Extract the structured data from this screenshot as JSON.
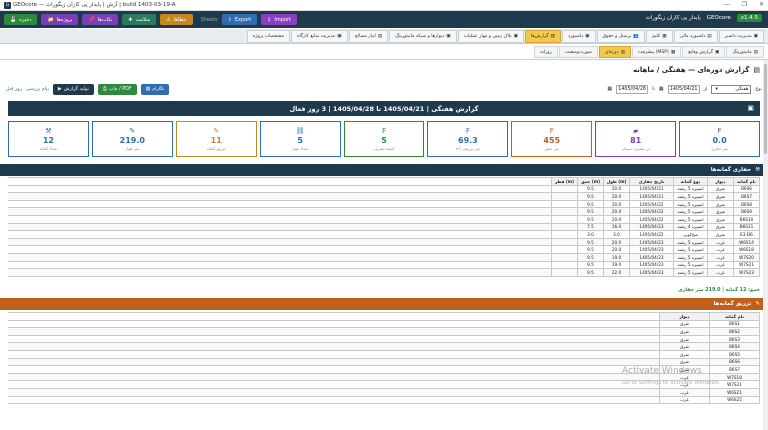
{
  "window": {
    "icon": "G",
    "title": "GEOcore — آرش | پایدار پی کاران زیگورات | build 1403-03-19-A",
    "controls": [
      "—",
      "❐",
      "✕"
    ]
  },
  "topbar": {
    "buttons": [
      {
        "label": "ذخیره",
        "icon": "💾"
      },
      {
        "label": "پروژه‌ها",
        "icon": "📁"
      },
      {
        "label": "نکات‌ها",
        "icon": "📌"
      },
      {
        "label": "سلامت",
        "icon": "✚"
      },
      {
        "label": "خطاها",
        "icon": "⚠"
      }
    ],
    "sep": "Sheets",
    "export": "Export",
    "import": "Import",
    "brand": "پایدار پی کاران زیگورات",
    "app": "GEOcore",
    "version": "v1.4.5"
  },
  "tabs": [
    {
      "label": "مدیریت داشبر",
      "icon": "▣",
      "active": false
    },
    {
      "label": "داشبورد مالی",
      "icon": "▤",
      "active": false
    },
    {
      "label": "کلیم",
      "icon": "▦",
      "active": false
    },
    {
      "label": "پرسنل و حقوق",
      "icon": "👥",
      "active": false
    },
    {
      "label": "داشبورد",
      "icon": "▣",
      "active": false
    },
    {
      "label": "گزارش‌ها",
      "icon": "▥",
      "active": true
    },
    {
      "label": "بلاک زمین و مهار عملیات",
      "icon": "▣",
      "active": false
    },
    {
      "label": "دیوارها و شبکه مانیتورینگ",
      "icon": "▣",
      "active": false
    },
    {
      "label": "انبار مصالح",
      "icon": "▤",
      "active": false
    },
    {
      "label": "مدیریت منابع کارگاه",
      "icon": "▣",
      "active": false
    },
    {
      "label": "مشخصات پروژه",
      "icon": "",
      "active": false
    }
  ],
  "subtabs": [
    {
      "label": "مانیتورینگ",
      "icon": "▤",
      "active": false
    },
    {
      "label": "گزارش وقایع",
      "icon": "▣",
      "active": false
    },
    {
      "label": "پیشرفت (MSP)",
      "icon": "▦",
      "active": false
    },
    {
      "label": "دوره‌ای",
      "icon": "▥",
      "active": true
    },
    {
      "label": "صورت‌وضعیت",
      "icon": "",
      "active": false
    },
    {
      "label": "روزانه",
      "icon": "",
      "active": false
    }
  ],
  "header": {
    "title": "گزارش دوره‌ای — هفتگی / ماهانه",
    "icon": "▤"
  },
  "filters": {
    "type_label": "نوع",
    "type_value": "هفتگی",
    "from_label": "از",
    "from_value": "1405/04/21",
    "to_label": "تا",
    "to_value": "1405/04/28",
    "generate": "تولید گزارش",
    "print": "چاپ / PDF",
    "graph": "نگارام",
    "link1": "پیام بررسی",
    "link2": "روز قبل"
  },
  "banner": {
    "text": "گزارش هفتگی  |  1405/04/21 تا 1405/04/28  |  3 روز فعال",
    "icon": "▣"
  },
  "cards": [
    {
      "icon": "F",
      "value": "0.0",
      "label": "متر حفاری",
      "color": "#2f6db0"
    },
    {
      "icon": "▰",
      "value": "81",
      "label": "تن مصرف سیمان",
      "color": "#7b3fb5"
    },
    {
      "icon": "F",
      "value": "455",
      "label": "متر عمق",
      "color": "#c0601c"
    },
    {
      "icon": "F",
      "value": "69.3",
      "label": "m³ بتن تزریقی",
      "color": "#2f6db0"
    },
    {
      "icon": "F",
      "value": "5",
      "label": "کیسه مصرف",
      "color": "#2d8a3c"
    },
    {
      "icon": "⛓",
      "value": "5",
      "label": "تعداد مهار",
      "color": "#2f6db0"
    },
    {
      "icon": "✎",
      "value": "11",
      "label": "تزریق گمانه",
      "color": "#c48a1c"
    },
    {
      "icon": "✎",
      "value": "219.0",
      "label": "متر طول",
      "color": "#2f6db0"
    },
    {
      "icon": "⚒",
      "value": "12",
      "label": "تعداد گمانه",
      "color": "#2f6db0"
    }
  ],
  "section1": {
    "title": "حفاری گمانه‌ها",
    "icon": "⚒"
  },
  "table1": {
    "headers": [
      "نام گمانه",
      "دیوار",
      "نوع گمانه",
      "تاریخ حفاری",
      "طول (m)",
      "عمق (m)",
      "قطر (m)"
    ],
    "rows": [
      [
        "B6S6",
        "شرق",
        "اسپیره 5 رشته",
        "1405/04/21",
        "20.0",
        "9.5",
        ""
      ],
      [
        "B6S7",
        "شرق",
        "اسپیره 5 رشته",
        "1405/04/21",
        "20.0",
        "9.5",
        ""
      ],
      [
        "B6S8",
        "شرق",
        "اسپیره 5 رشته",
        "1405/04/22",
        "20.0",
        "9.5",
        ""
      ],
      [
        "B6S9",
        "شرق",
        "اسپیره 5 رشته",
        "1405/04/22",
        "20.0",
        "9.5",
        ""
      ],
      [
        "B6S10",
        "شرق",
        "اسپیره 5 رشته",
        "1405/04/22",
        "20.0",
        "9.5",
        ""
      ],
      [
        "B6S11",
        "شرق",
        "اسپیره 4 رشته",
        "1405/04/23",
        "16.0",
        "7.5",
        ""
      ],
      [
        "E3-D6",
        "شرق",
        "میخ‌کوبی",
        "1405/04/22",
        "3.0",
        "3.0",
        ""
      ],
      [
        "W6S14",
        "غرب",
        "اسپیره 5 رشته",
        "1405/04/23",
        "20.0",
        "9.5",
        ""
      ],
      [
        "W6S18",
        "غرب",
        "اسپیره 5 رشته",
        "1405/04/23",
        "20.0",
        "9.5",
        ""
      ],
      [
        "W7S20",
        "غرب",
        "اسپیره 5 رشته",
        "1405/04/23",
        "19.0",
        "9.5",
        ""
      ],
      [
        "W7S21",
        "غرب",
        "اسپیره 5 رشته",
        "1405/04/23",
        "19.0",
        "9.5",
        ""
      ],
      [
        "W7S23",
        "غرب",
        "اسپیره 5 رشته",
        "1405/04/23",
        "22.0",
        "9.5",
        ""
      ]
    ]
  },
  "total": "جمع: 12 گمانه  |  219.0 متر حفاری",
  "section2": {
    "title": "تزریق گمانه‌ها",
    "icon": "✎"
  },
  "table2": {
    "headers": [
      "نام گمانه",
      "دیوار"
    ],
    "rows": [
      [
        "B6S1",
        "شرق"
      ],
      [
        "B6S2",
        "شرق"
      ],
      [
        "B6S3",
        "شرق"
      ],
      [
        "B6S4",
        "شرق"
      ],
      [
        "B6S5",
        "شرق"
      ],
      [
        "B6S6",
        "شرق"
      ],
      [
        "B6S7",
        "شرق"
      ],
      [
        "W7S18",
        "غرب"
      ],
      [
        "W7S21",
        "غرب"
      ],
      [
        "W6S21",
        "غرب"
      ],
      [
        "W6S25",
        "غرب"
      ]
    ]
  },
  "watermark": {
    "title": "Activate Windows",
    "sub": "Go to Settings to activate Windows."
  }
}
